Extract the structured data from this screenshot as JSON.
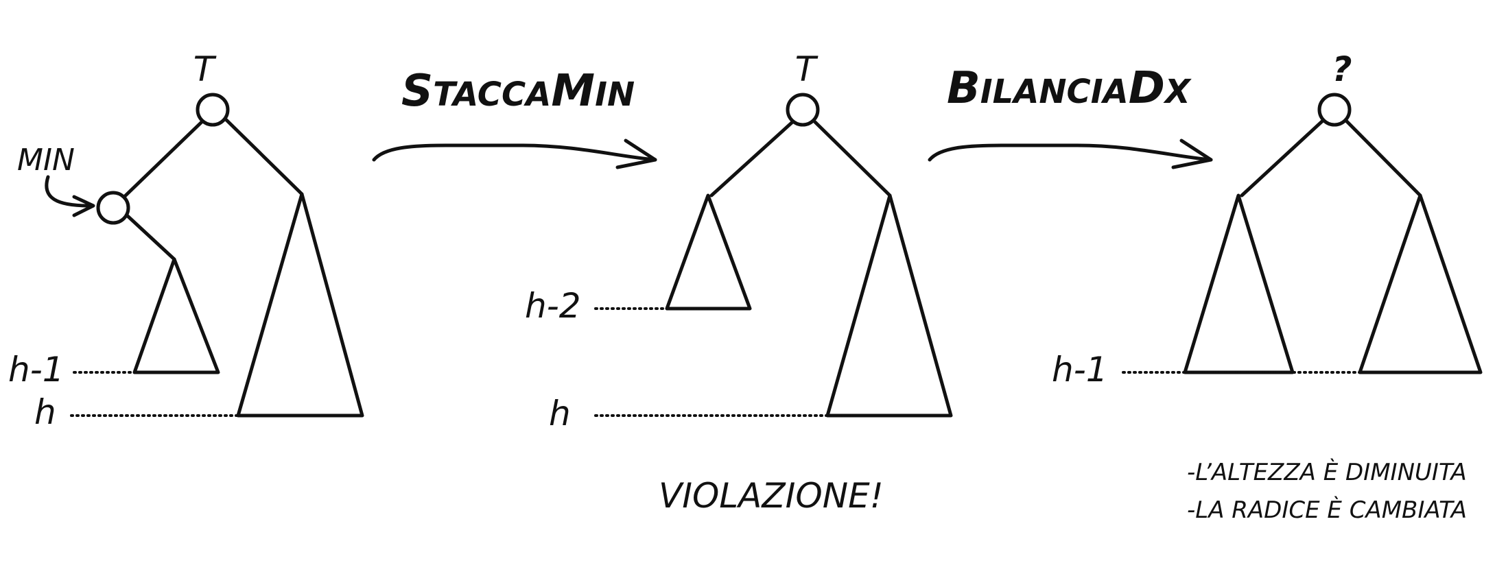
{
  "panel1": {
    "root_label": "T",
    "min_label": "MIN",
    "height_left": "h-1",
    "height_right": "h"
  },
  "op1": {
    "first": "S",
    "mid": "TACCA",
    "cap": "M",
    "rest": "IN"
  },
  "panel2": {
    "root_label": "T",
    "height_left": "h-2",
    "height_right": "h",
    "violation": "VIOLAZIONE!"
  },
  "op2": {
    "first": "B",
    "mid": "ILANCIA",
    "cap": "D",
    "rest": "X"
  },
  "panel3": {
    "root_label": "?",
    "height": "h-1",
    "notes": [
      "-L’ALTEZZA È DIMINUITA",
      "-LA RADICE È CAMBIATA"
    ]
  }
}
